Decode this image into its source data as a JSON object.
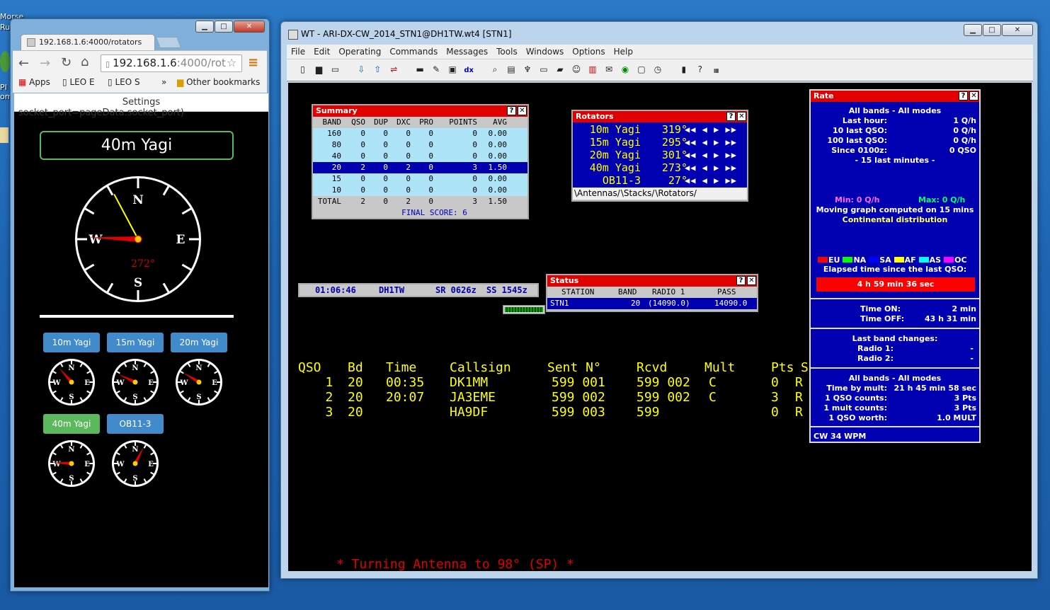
{
  "desktop": {
    "label1": "Morse",
    "label2": "Ru",
    "label3": "PI",
    "label4": "om"
  },
  "chrome": {
    "tab_title": "192.168.1.6:4000/rotators",
    "url_host": "192.168.1.6",
    "url_rest": ":4000/rot",
    "bookmarks": {
      "apps": "Apps",
      "b1": "LEO E",
      "b2": "LEO S",
      "more": "»",
      "other": "Other bookmarks"
    },
    "settings": "Settings",
    "overflow_text": "socket_port=pageData.socket_port)",
    "main_title": "40m Yagi",
    "main_compass": {
      "N": "N",
      "E": "E",
      "S": "S",
      "W": "W",
      "degree": "272°",
      "heading": 272,
      "yellow_heading": 332
    },
    "rotators": [
      {
        "label": "10m Yagi",
        "heading": 319,
        "active": false
      },
      {
        "label": "15m Yagi",
        "heading": 295,
        "active": false
      },
      {
        "label": "20m Yagi",
        "heading": 301,
        "active": false
      },
      {
        "label": "40m Yagi",
        "heading": 273,
        "active": true
      },
      {
        "label": "OB11-3",
        "heading": 27,
        "active": false
      }
    ]
  },
  "wt": {
    "title": "WT - ARI-DX-CW_2014_STN1@DH1TW.wt4 [STN1]",
    "menu": [
      "File",
      "Edit",
      "Operating",
      "Commands",
      "Messages",
      "Tools",
      "Windows",
      "Options",
      "Help"
    ],
    "summary": {
      "title": "Summary",
      "headers": [
        "BAND",
        "QSO",
        "DUP",
        "DXC",
        "PRO",
        "POINTS",
        "AVG"
      ],
      "rows": [
        [
          "160",
          "0",
          "0",
          "0",
          "0",
          "0",
          "0.00"
        ],
        [
          "80",
          "0",
          "0",
          "0",
          "0",
          "0",
          "0.00"
        ],
        [
          "40",
          "0",
          "0",
          "0",
          "0",
          "0",
          "0.00"
        ],
        [
          "20",
          "2",
          "0",
          "2",
          "0",
          "3",
          "1.50"
        ],
        [
          "15",
          "0",
          "0",
          "0",
          "0",
          "0",
          "0.00"
        ],
        [
          "10",
          "0",
          "0",
          "0",
          "0",
          "0",
          "0.00"
        ]
      ],
      "total": [
        "TOTAL",
        "2",
        "0",
        "2",
        "0",
        "3",
        "1.50"
      ],
      "final_score": "FINAL SCORE: 6"
    },
    "rotators_panel": {
      "title": "Rotators",
      "rows": [
        {
          "name": "10m Yagi",
          "deg": "319°"
        },
        {
          "name": "15m Yagi",
          "deg": "295°"
        },
        {
          "name": "20m Yagi",
          "deg": "301°"
        },
        {
          "name": "40m Yagi",
          "deg": "273°"
        },
        {
          "name": "OB11-3",
          "deg": "27°"
        }
      ],
      "tabs": [
        "Antennas",
        "Stacks",
        "Rotators"
      ]
    },
    "clock": {
      "time": "01:06:46",
      "call": "DH1TW",
      "sr": "SR 0626z",
      "ss": "SS 1545z"
    },
    "status": {
      "title": "Status",
      "headers": [
        "STATION",
        "BAND",
        "RADIO 1",
        "PASS"
      ],
      "row": [
        "STN1",
        "20",
        "(14090.0)",
        "14090.0"
      ]
    },
    "log": {
      "headers": [
        "QSO",
        "Bd",
        "Time",
        "Callsign",
        "Sent N°",
        "Rcvd",
        "Mult",
        "Pts",
        "Stn"
      ],
      "rows": [
        [
          "1",
          "20",
          "00:35",
          "DK1MM",
          "599 001",
          "599 002",
          "C",
          "0",
          "R"
        ],
        [
          "2",
          "20",
          "20:07",
          "JA3EME",
          "599 002",
          "599 002",
          "C",
          "3",
          "R"
        ],
        [
          "3",
          "20",
          "",
          "HA9DF",
          "599 003",
          "599",
          "",
          "0",
          "R"
        ]
      ]
    },
    "message": "* Turning Antenna to 98° (SP) *",
    "rate": {
      "title": "Rate",
      "heading": "All bands - All modes",
      "items": [
        {
          "k": "Last hour:",
          "v": "1 Q/h"
        },
        {
          "k": "10 last QSO:",
          "v": "0 Q/h"
        },
        {
          "k": "100 last QSO:",
          "v": "0 Q/h"
        },
        {
          "k": "Since 0100z:",
          "v": "0 QSO"
        }
      ],
      "last15": "- 15 last minutes -",
      "min": "Min: 0 Q/h",
      "max": "Max: 0 Q/h",
      "moving": "Moving graph computed on 15 mins",
      "continental": "Continental distribution",
      "legend": [
        {
          "label": "EU",
          "color": "#ff0000"
        },
        {
          "label": "NA",
          "color": "#00ff00"
        },
        {
          "label": "SA",
          "color": "#0000ff"
        },
        {
          "label": "AF",
          "color": "#ffff00"
        },
        {
          "label": "AS",
          "color": "#00ffff"
        },
        {
          "label": "OC",
          "color": "#ff00ff"
        }
      ],
      "elapsed_label": "Elapsed time since the last QSO:",
      "elapsed": "4 h 59 min 36 sec",
      "time_on_k": "Time ON:",
      "time_on_v": "2 min",
      "time_off_k": "Time OFF:",
      "time_off_v": "43 h 31 min",
      "band_changes": "Last band changes:",
      "radio1_k": "Radio 1:",
      "radio1_v": "-",
      "radio2_k": "Radio 2:",
      "radio2_v": "-",
      "heading2": "All bands - All modes",
      "items2": [
        {
          "k": "Time by mult:",
          "v": "21 h 45 min 58 sec"
        },
        {
          "k": "1 QSO counts:",
          "v": "3 Pts"
        },
        {
          "k": "1 mult counts:",
          "v": "3 Pts"
        },
        {
          "k": "1 QSO worth:",
          "v": "1.0 MULT"
        }
      ],
      "footer": "CW 34 WPM"
    }
  }
}
